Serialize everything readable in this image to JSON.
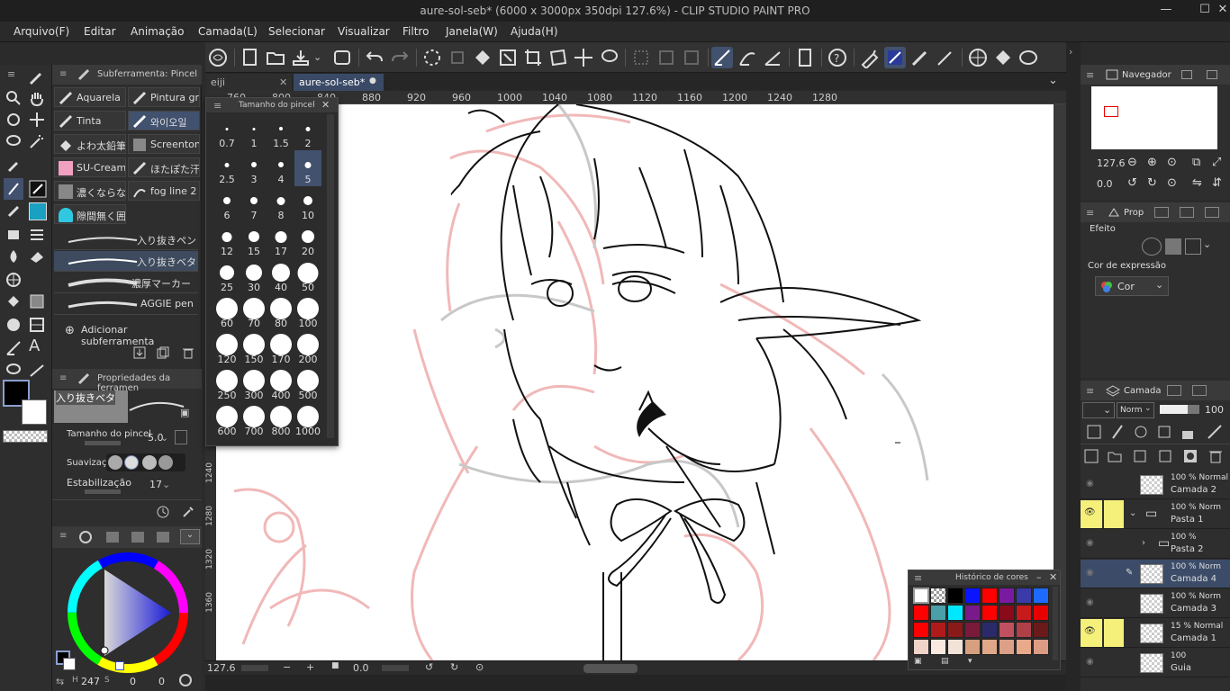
{
  "title_bar": {
    "title": "aure-sol-seb* (6000 x 3000px 350dpi 127.6%) - CLIP STUDIO PAINT PRO",
    "minimize": "—",
    "maximize": "☐",
    "close": "✕"
  },
  "menu": [
    "Arquivo(F)",
    "Editar",
    "Animação",
    "Camada(L)",
    "Selecionar",
    "Visualizar",
    "Filtro",
    "Janela(W)",
    "Ajuda(H)"
  ],
  "tabs": [
    {
      "label": "eiji",
      "close": "✕"
    },
    {
      "label": "aure-sol-seb*",
      "close": "●"
    }
  ],
  "ruler_top": [
    "760",
    "800",
    "840",
    "880",
    "920",
    "960",
    "1000",
    "1040",
    "1080",
    "1120",
    "1160",
    "1200",
    "1240",
    "1280"
  ],
  "ruler_left": [
    "1240",
    "1280",
    "1320",
    "1360"
  ],
  "subtool_panel": {
    "header": "Subferramenta: Pincel",
    "items": [
      {
        "label": "Aquarela",
        "active": false
      },
      {
        "label": "Pintura gro",
        "active": false
      },
      {
        "label": "Tinta",
        "active": false
      },
      {
        "label": "와이오일",
        "active": true
      },
      {
        "label": "よわ太鉛筆",
        "active": false
      },
      {
        "label": "Screentone",
        "active": false
      },
      {
        "label": "SU-Cream",
        "active": false
      },
      {
        "label": "ほたぽた汗",
        "active": false
      },
      {
        "label": "濃くならな",
        "active": false
      },
      {
        "label": "fog line 2",
        "active": false
      },
      {
        "label": "隙間無く囲",
        "active": false
      }
    ],
    "strokes": [
      "入り抜きペン",
      "入り抜きベタ",
      "濃厚マーカー",
      "AGGIE pen"
    ],
    "add_subtool": "Adicionar subferramenta"
  },
  "tool_properties": {
    "header": "Propriedades da ferramen",
    "brush_name": "入り抜きベタ",
    "size_label": "Tamanho do pincel",
    "size_value": "5.0",
    "smoothing_label": "Suavização",
    "stabilization_label": "Estabilização",
    "stabilization_value": "17"
  },
  "brush_size_palette": {
    "title": "Tamanho do pincel",
    "sizes": [
      "0.7",
      "1",
      "1.5",
      "2",
      "2.5",
      "3",
      "4",
      "5",
      "6",
      "7",
      "8",
      "10",
      "12",
      "15",
      "17",
      "20",
      "25",
      "30",
      "40",
      "50",
      "60",
      "70",
      "80",
      "100",
      "120",
      "150",
      "170",
      "200",
      "250",
      "300",
      "400",
      "500",
      "600",
      "700",
      "800",
      "1000"
    ],
    "selected": "5"
  },
  "color_wheel": {
    "readout_h": "247",
    "readout_s": "0",
    "readout_v": "0"
  },
  "canvas_status": {
    "zoom": "127.6",
    "angle": "0.0"
  },
  "navigator": {
    "header": "Navegador",
    "zoom": "127.6",
    "angle": "0.0"
  },
  "property_panel": {
    "header": "Prop",
    "effect_label": "Efeito",
    "expression_label": "Cor de expressão",
    "expression_value": "Cor"
  },
  "layer_panel": {
    "header": "Camada",
    "blend_mode": "Norm",
    "opacity": "100",
    "layers": [
      {
        "opacity": "100 % Normal",
        "name": "Camada 2",
        "eye": false,
        "folder": false,
        "selected": false,
        "indent": 0
      },
      {
        "opacity": "100 % Norm",
        "name": "Pasta 1",
        "eye": true,
        "folder": true,
        "selected": false,
        "indent": 0
      },
      {
        "opacity": "100 %",
        "name": "Pasta 2",
        "eye": false,
        "folder": true,
        "selected": false,
        "indent": 1
      },
      {
        "opacity": "100 % Norm",
        "name": "Camada 4",
        "eye": false,
        "folder": false,
        "selected": true,
        "indent": 1
      },
      {
        "opacity": "100 % Norm",
        "name": "Camada 3",
        "eye": false,
        "folder": false,
        "selected": false,
        "indent": 1
      },
      {
        "opacity": "15 % Normal",
        "name": "Camada 1",
        "eye": true,
        "folder": false,
        "selected": false,
        "indent": 1
      },
      {
        "opacity": "100",
        "name": "Guia",
        "eye": false,
        "folder": false,
        "selected": false,
        "indent": 0
      }
    ]
  },
  "color_history": {
    "title": "Histórico de cores",
    "swatches": [
      "#ffffff",
      "transparent",
      "#000000",
      "#0a14ff",
      "#ff0000",
      "#7a1aa0",
      "#3a3aa8",
      "#1e6aff",
      "#ff0000",
      "#4aa0a8",
      "#00e8ff",
      "#7a1a8a",
      "#ff0000",
      "#8a0a1a",
      "#c81a1a",
      "#e80000",
      "#ff0000",
      "#b01a1a",
      "#8a1a1a",
      "#7a1a3a",
      "#2a2a6a",
      "#c05060",
      "#b04048",
      "#6a1a1a",
      "#f0d4c8",
      "#fbe9e0",
      "#f3e2d8",
      "#d6a080",
      "#e0a888",
      "#dca088",
      "#e8aa8a",
      "#dc9c84"
    ]
  },
  "colors": {
    "accent": "#41516e",
    "eye_highlight": "#f4f07a",
    "main_color": "#000000",
    "sub_color": "#ffffff"
  }
}
